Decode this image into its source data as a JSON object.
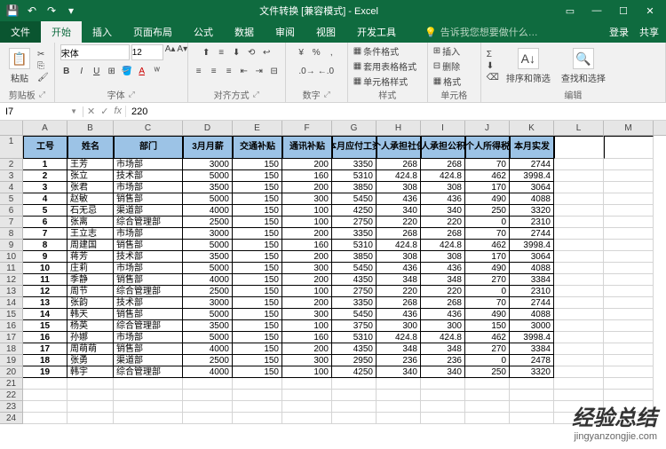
{
  "titlebar": {
    "title": "文件转换 [兼容模式] - Excel"
  },
  "ribbon_tabs": {
    "file": "文件",
    "home": "开始",
    "insert": "插入",
    "page_layout": "页面布局",
    "formulas": "公式",
    "data": "数据",
    "review": "审阅",
    "view": "视图",
    "developer": "开发工具",
    "tell_me": "告诉我您想要做什么…",
    "login": "登录",
    "share": "共享"
  },
  "ribbon": {
    "clipboard": {
      "label": "剪贴板",
      "paste": "粘贴"
    },
    "font": {
      "label": "字体",
      "name": "宋体",
      "size": "12"
    },
    "alignment": {
      "label": "对齐方式"
    },
    "number": {
      "label": "数字"
    },
    "styles": {
      "label": "样式",
      "cond_format": "条件格式",
      "format_table": "套用表格格式",
      "cell_styles": "单元格样式"
    },
    "cells": {
      "label": "单元格",
      "insert": "插入",
      "delete": "删除",
      "format": "格式"
    },
    "editing": {
      "label": "编辑",
      "sort_filter": "排序和筛选",
      "find_select": "查找和选择"
    }
  },
  "formula_bar": {
    "name_box": "I7",
    "fx": "fx",
    "value": "220"
  },
  "columns": [
    "A",
    "B",
    "C",
    "D",
    "E",
    "F",
    "G",
    "H",
    "I",
    "J",
    "K",
    "L",
    "M"
  ],
  "headers": [
    "工号",
    "姓名",
    "部门",
    "3月月薪",
    "交通补贴",
    "通讯补贴",
    "本月应付工资",
    "个人承担社保",
    "个人承担公积金",
    "个人所得税",
    "本月实发"
  ],
  "rows": [
    {
      "n": "1",
      "name": "王芳",
      "dept": "市场部",
      "sal": 3000,
      "tr": 150,
      "tel": 200,
      "due": 3350,
      "ss": 268,
      "hf": 268,
      "tax": 70,
      "net": 2744
    },
    {
      "n": "2",
      "name": "张立",
      "dept": "技术部",
      "sal": 5000,
      "tr": 150,
      "tel": 160,
      "due": 5310,
      "ss": 424.8,
      "hf": 424.8,
      "tax": 462,
      "net": "3998.4"
    },
    {
      "n": "3",
      "name": "张君",
      "dept": "市场部",
      "sal": 3500,
      "tr": 150,
      "tel": 200,
      "due": 3850,
      "ss": 308,
      "hf": 308,
      "tax": 170,
      "net": 3064
    },
    {
      "n": "4",
      "name": "赵敏",
      "dept": "销售部",
      "sal": 5000,
      "tr": 150,
      "tel": 300,
      "due": 5450,
      "ss": 436,
      "hf": 436,
      "tax": 490,
      "net": 4088
    },
    {
      "n": "5",
      "name": "石无忌",
      "dept": "渠道部",
      "sal": 4000,
      "tr": 150,
      "tel": 100,
      "due": 4250,
      "ss": 340,
      "hf": 340,
      "tax": 250,
      "net": 3320
    },
    {
      "n": "6",
      "name": "张离",
      "dept": "综合管理部",
      "sal": 2500,
      "tr": 150,
      "tel": 100,
      "due": 2750,
      "ss": 220,
      "hf": 220,
      "tax": 0,
      "net": 2310
    },
    {
      "n": "7",
      "name": "王立志",
      "dept": "市场部",
      "sal": 3000,
      "tr": 150,
      "tel": 200,
      "due": 3350,
      "ss": 268,
      "hf": 268,
      "tax": 70,
      "net": 2744
    },
    {
      "n": "8",
      "name": "周建国",
      "dept": "销售部",
      "sal": 5000,
      "tr": 150,
      "tel": 160,
      "due": 5310,
      "ss": 424.8,
      "hf": 424.8,
      "tax": 462,
      "net": "3998.4"
    },
    {
      "n": "9",
      "name": "蒋芳",
      "dept": "技术部",
      "sal": 3500,
      "tr": 150,
      "tel": 200,
      "due": 3850,
      "ss": 308,
      "hf": 308,
      "tax": 170,
      "net": 3064
    },
    {
      "n": "10",
      "name": "庄莉",
      "dept": "市场部",
      "sal": 5000,
      "tr": 150,
      "tel": 300,
      "due": 5450,
      "ss": 436,
      "hf": 436,
      "tax": 490,
      "net": 4088
    },
    {
      "n": "11",
      "name": "季静",
      "dept": "销售部",
      "sal": 4000,
      "tr": 150,
      "tel": 200,
      "due": 4350,
      "ss": 348,
      "hf": 348,
      "tax": 270,
      "net": 3384
    },
    {
      "n": "12",
      "name": "周节",
      "dept": "综合管理部",
      "sal": 2500,
      "tr": 150,
      "tel": 100,
      "due": 2750,
      "ss": 220,
      "hf": 220,
      "tax": 0,
      "net": 2310
    },
    {
      "n": "13",
      "name": "张韵",
      "dept": "技术部",
      "sal": 3000,
      "tr": 150,
      "tel": 200,
      "due": 3350,
      "ss": 268,
      "hf": 268,
      "tax": 70,
      "net": 2744
    },
    {
      "n": "14",
      "name": "韩天",
      "dept": "销售部",
      "sal": 5000,
      "tr": 150,
      "tel": 300,
      "due": 5450,
      "ss": 436,
      "hf": 436,
      "tax": 490,
      "net": 4088
    },
    {
      "n": "15",
      "name": "杨英",
      "dept": "综合管理部",
      "sal": 3500,
      "tr": 150,
      "tel": 100,
      "due": 3750,
      "ss": 300,
      "hf": 300,
      "tax": 150,
      "net": 3000
    },
    {
      "n": "16",
      "name": "孙娜",
      "dept": "市场部",
      "sal": 5000,
      "tr": 150,
      "tel": 160,
      "due": 5310,
      "ss": 424.8,
      "hf": 424.8,
      "tax": 462,
      "net": "3998.4"
    },
    {
      "n": "17",
      "name": "周萌萌",
      "dept": "销售部",
      "sal": 4000,
      "tr": 150,
      "tel": 200,
      "due": 4350,
      "ss": 348,
      "hf": 348,
      "tax": 270,
      "net": 3384
    },
    {
      "n": "18",
      "name": "张勇",
      "dept": "渠道部",
      "sal": 2500,
      "tr": 150,
      "tel": 300,
      "due": 2950,
      "ss": 236,
      "hf": 236,
      "tax": 0,
      "net": 2478
    },
    {
      "n": "19",
      "name": "韩宇",
      "dept": "综合管理部",
      "sal": 4000,
      "tr": 150,
      "tel": 100,
      "due": 4250,
      "ss": 340,
      "hf": 340,
      "tax": 250,
      "net": 3320
    }
  ],
  "watermark": {
    "line1": "经验总结",
    "line2": "jingyanzongjie.com"
  }
}
